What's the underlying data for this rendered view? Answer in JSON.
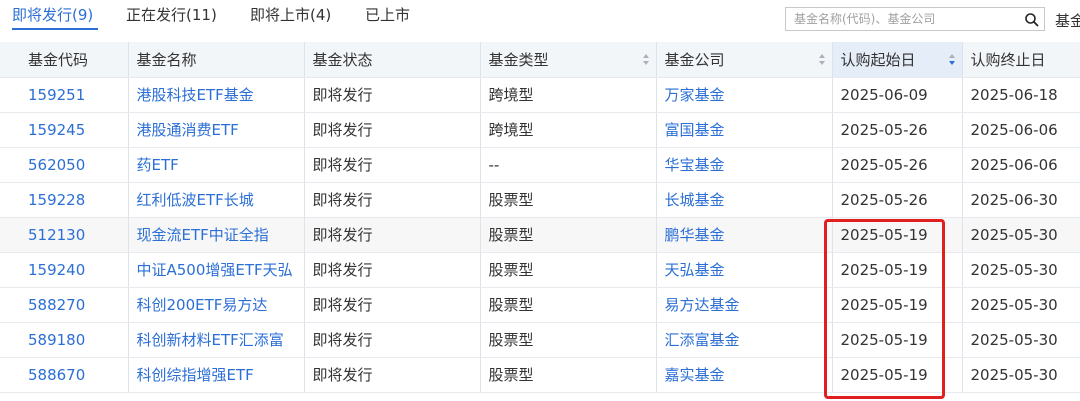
{
  "tabs": [
    {
      "label": "即将发行(9)",
      "active": true
    },
    {
      "label": "正在发行(11)",
      "active": false
    },
    {
      "label": "即将上市(4)",
      "active": false
    },
    {
      "label": "已上市",
      "active": false
    }
  ],
  "search": {
    "placeholder": "基金名称(代码)、基金公司",
    "icon": "search-icon"
  },
  "header_extra_label": "基金",
  "table": {
    "columns": [
      "基金代码",
      "基金名称",
      "基金状态",
      "基金类型",
      "基金公司",
      "认购起始日",
      "认购终止日"
    ],
    "sorted_column": "认购起始日",
    "rows": [
      {
        "code": "159251",
        "name": "港股科技ETF基金",
        "status": "即将发行",
        "type": "跨境型",
        "company": "万家基金",
        "start": "2025-06-09",
        "end": "2025-06-18"
      },
      {
        "code": "159245",
        "name": "港股通消费ETF",
        "status": "即将发行",
        "type": "跨境型",
        "company": "富国基金",
        "start": "2025-05-26",
        "end": "2025-06-06"
      },
      {
        "code": "562050",
        "name": "药ETF",
        "status": "即将发行",
        "type": "--",
        "company": "华宝基金",
        "start": "2025-05-26",
        "end": "2025-06-06"
      },
      {
        "code": "159228",
        "name": "红利低波ETF长城",
        "status": "即将发行",
        "type": "股票型",
        "company": "长城基金",
        "start": "2025-05-26",
        "end": "2025-06-30"
      },
      {
        "code": "512130",
        "name": "现金流ETF中证全指",
        "status": "即将发行",
        "type": "股票型",
        "company": "鹏华基金",
        "start": "2025-05-19",
        "end": "2025-05-30"
      },
      {
        "code": "159240",
        "name": "中证A500增强ETF天弘",
        "status": "即将发行",
        "type": "股票型",
        "company": "天弘基金",
        "start": "2025-05-19",
        "end": "2025-05-30"
      },
      {
        "code": "588270",
        "name": "科创200ETF易方达",
        "status": "即将发行",
        "type": "股票型",
        "company": "易方达基金",
        "start": "2025-05-19",
        "end": "2025-05-30"
      },
      {
        "code": "589180",
        "name": "科创新材料ETF汇添富",
        "status": "即将发行",
        "type": "股票型",
        "company": "汇添富基金",
        "start": "2025-05-19",
        "end": "2025-05-30"
      },
      {
        "code": "588670",
        "name": "科创综指增强ETF",
        "status": "即将发行",
        "type": "股票型",
        "company": "嘉实基金",
        "start": "2025-05-19",
        "end": "2025-05-30"
      }
    ]
  },
  "colors": {
    "accent": "#2b6fd6",
    "highlight": "#e02020"
  }
}
